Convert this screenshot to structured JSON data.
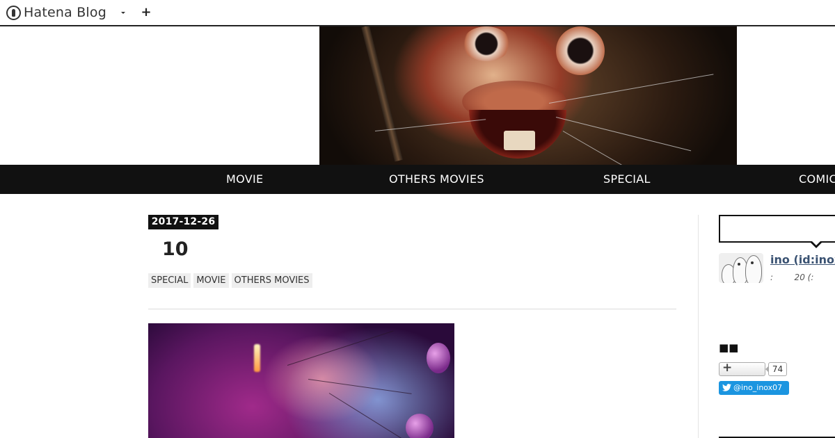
{
  "topbar": {
    "logo_text": "Hatena Blog",
    "logo_icon": "hatena-pen-icon",
    "dropdown_icon": "caret-down-icon",
    "add_label": "+"
  },
  "header": {
    "image_alt": "bloody rabbit mask header image"
  },
  "nav": {
    "items": [
      {
        "label": "MOVIE"
      },
      {
        "label": "OTHERS MOVIES"
      },
      {
        "label": "SPECIAL"
      },
      {
        "label": "COMIC"
      }
    ]
  },
  "article": {
    "date": "2017-12-26",
    "title": "10",
    "categories": [
      "SPECIAL",
      "MOVIE",
      "OTHERS MOVIES"
    ]
  },
  "sidebar": {
    "profile_name": "ino (id:inox",
    "profile_meta": ":        20 (:",
    "section_title": "■■",
    "follow_count": "74",
    "twitter_handle": "@ino_inox07"
  },
  "colors": {
    "nav_bg": "#111111",
    "twitter": "#1b95e0",
    "link": "#3a5272",
    "category_bg": "#eeeeee"
  }
}
